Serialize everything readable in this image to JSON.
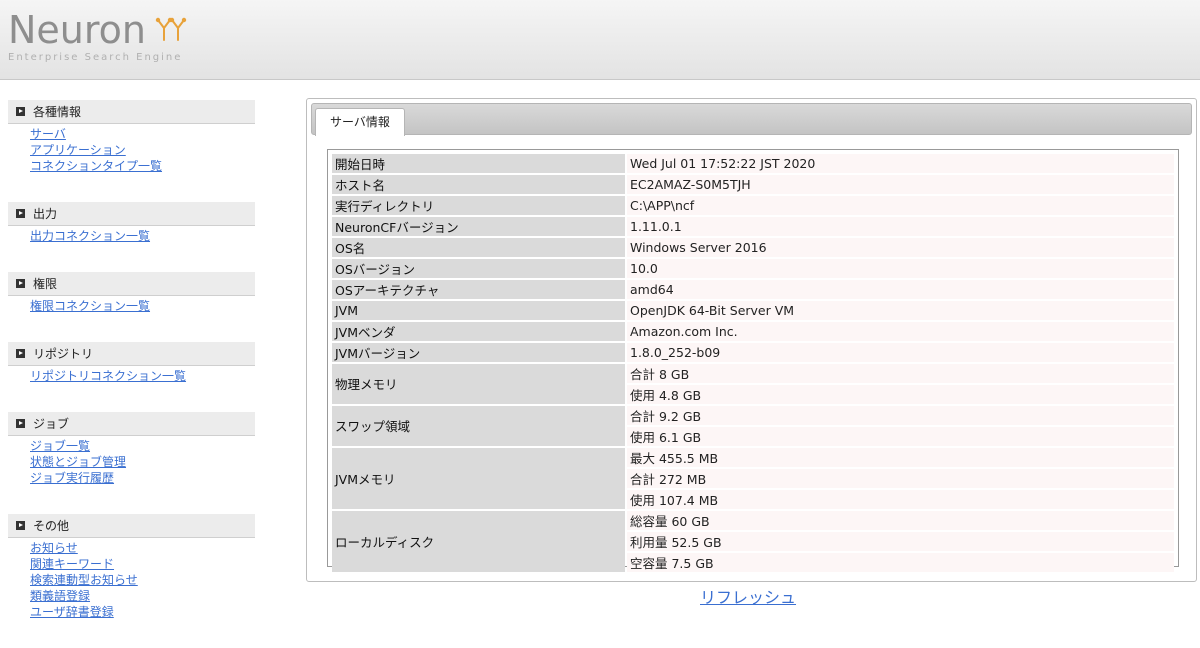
{
  "header": {
    "logo_text": "Neuron",
    "tagline": "Enterprise Search Engine"
  },
  "sidebar": {
    "sections": [
      {
        "title": "各種情報",
        "links": [
          "サーバ",
          "アプリケーション",
          "コネクションタイプ一覧"
        ]
      },
      {
        "title": "出力",
        "links": [
          "出力コネクション一覧"
        ]
      },
      {
        "title": "権限",
        "links": [
          "権限コネクション一覧"
        ]
      },
      {
        "title": "リポジトリ",
        "links": [
          "リポジトリコネクション一覧"
        ]
      },
      {
        "title": "ジョブ",
        "links": [
          "ジョブ一覧",
          "状態とジョブ管理",
          "ジョブ実行履歴"
        ]
      },
      {
        "title": "その他",
        "links": [
          "お知らせ",
          "関連キーワード",
          "検索連動型お知らせ",
          "類義語登録",
          "ユーザ辞書登録"
        ]
      }
    ]
  },
  "main": {
    "tab_label": "サーバ情報",
    "rows": [
      {
        "key": "開始日時",
        "values": [
          "Wed Jul 01 17:52:22 JST 2020"
        ]
      },
      {
        "key": "ホスト名",
        "values": [
          "EC2AMAZ-S0M5TJH"
        ]
      },
      {
        "key": "実行ディレクトリ",
        "values": [
          "C:\\APP\\ncf"
        ]
      },
      {
        "key": "NeuronCFバージョン",
        "values": [
          "1.11.0.1"
        ]
      },
      {
        "key": "OS名",
        "values": [
          "Windows Server 2016"
        ]
      },
      {
        "key": "OSバージョン",
        "values": [
          "10.0"
        ]
      },
      {
        "key": "OSアーキテクチャ",
        "values": [
          "amd64"
        ]
      },
      {
        "key": "JVM",
        "values": [
          "OpenJDK 64-Bit Server VM"
        ]
      },
      {
        "key": "JVMベンダ",
        "values": [
          "Amazon.com Inc."
        ]
      },
      {
        "key": "JVMバージョン",
        "values": [
          "1.8.0_252-b09"
        ]
      },
      {
        "key": "物理メモリ",
        "values": [
          "合計 8 GB",
          "使用 4.8 GB"
        ]
      },
      {
        "key": "スワップ領域",
        "values": [
          "合計 9.2 GB",
          "使用 6.1 GB"
        ]
      },
      {
        "key": "JVMメモリ",
        "values": [
          "最大 455.5 MB",
          "合計 272 MB",
          "使用 107.4 MB"
        ]
      },
      {
        "key": "ローカルディスク",
        "values": [
          "総容量 60 GB",
          "利用量 52.5 GB",
          "空容量 7.5 GB"
        ]
      }
    ],
    "refresh_label": "リフレッシュ"
  }
}
